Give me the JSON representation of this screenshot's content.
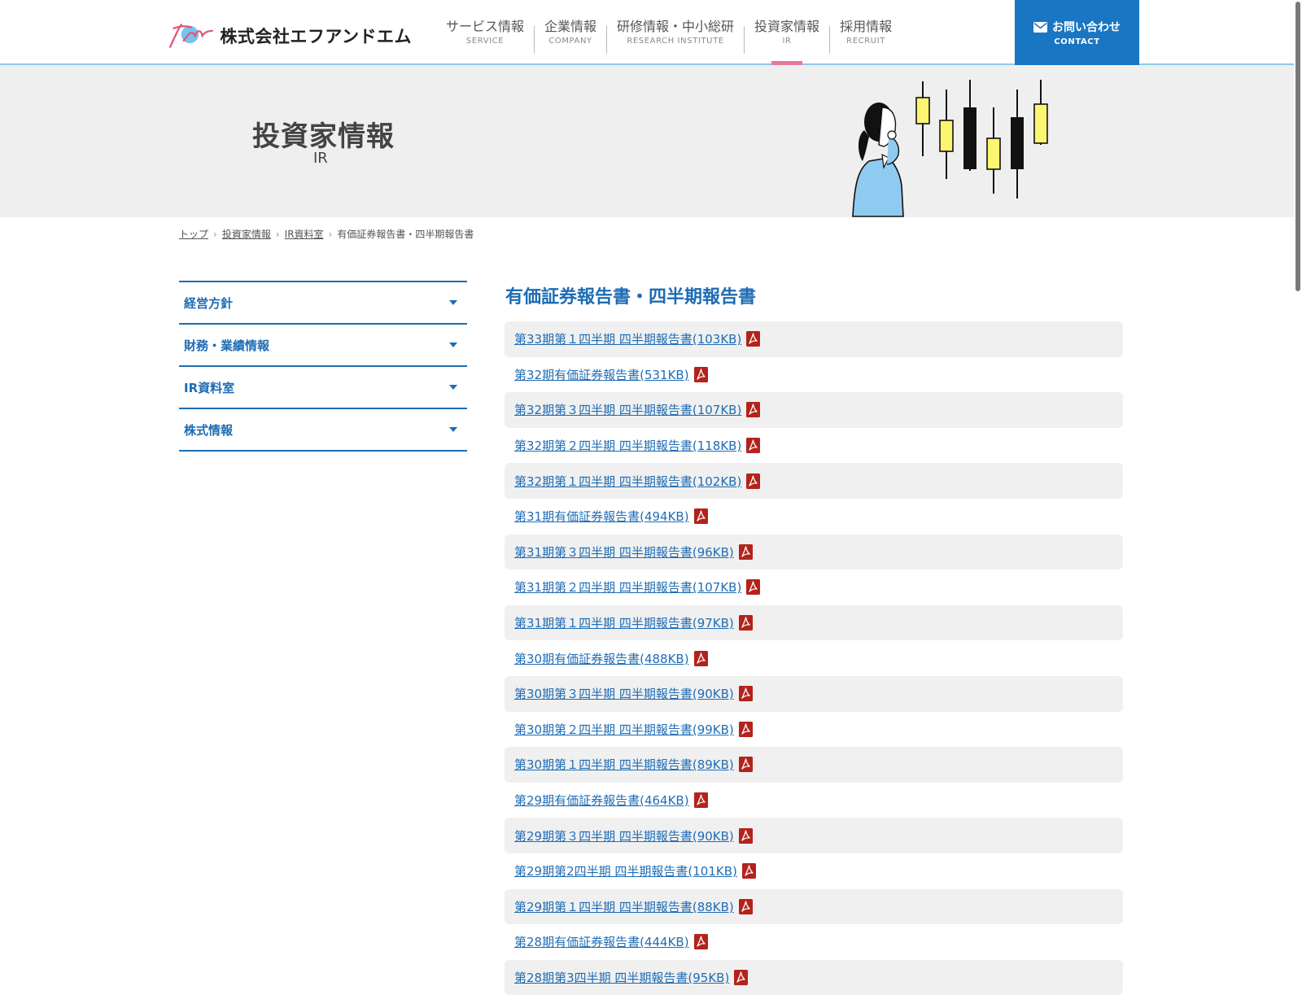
{
  "header": {
    "company_name": "株式会社エフアンドエム",
    "nav": [
      {
        "jp": "サービス情報",
        "en": "SERVICE"
      },
      {
        "jp": "企業情報",
        "en": "COMPANY"
      },
      {
        "jp": "研修情報・中小総研",
        "en": "RESEARCH INSTITUTE"
      },
      {
        "jp": "投資家情報",
        "en": "IR"
      },
      {
        "jp": "採用情報",
        "en": "RECRUIT"
      }
    ],
    "contact": {
      "jp": "お問い合わせ",
      "en": "CONTACT"
    }
  },
  "hero": {
    "title": "投資家情報",
    "subtitle": "IR"
  },
  "breadcrumb": [
    "トップ",
    "投資家情報",
    "IR資料室",
    "有価証券報告書・四半期報告書"
  ],
  "sidebar": {
    "items": [
      {
        "label": "経営方針"
      },
      {
        "label": "財務・業績情報"
      },
      {
        "label": "IR資料室"
      },
      {
        "label": "株式情報"
      }
    ]
  },
  "main": {
    "title": "有価証券報告書・四半期報告書",
    "reports": [
      "第33期第１四半期 四半期報告書(103KB)",
      "第32期有価証券報告書(531KB)",
      "第32期第３四半期 四半期報告書(107KB)",
      "第32期第２四半期 四半期報告書(118KB)",
      "第32期第１四半期 四半期報告書(102KB)",
      "第31期有価証券報告書(494KB)",
      "第31期第３四半期 四半期報告書(96KB)",
      "第31期第２四半期 四半期報告書(107KB)",
      "第31期第１四半期 四半期報告書(97KB)",
      "第30期有価証券報告書(488KB)",
      "第30期第３四半期 四半期報告書(90KB)",
      "第30期第２四半期 四半期報告書(99KB)",
      "第30期第１四半期 四半期報告書(89KB)",
      "第29期有価証券報告書(464KB)",
      "第29期第３四半期 四半期報告書(90KB)",
      "第29期第2四半期 四半期報告書(101KB)",
      "第29期第１四半期 四半期報告書(88KB)",
      "第28期有価証券報告書(444KB)",
      "第28期第3四半期 四半期報告書(95KB)"
    ]
  },
  "colors": {
    "accent": "#1d6cb4",
    "contact_bg": "#1976c2",
    "active_marker": "#e7789c",
    "pdf_red": "#c0392b"
  }
}
